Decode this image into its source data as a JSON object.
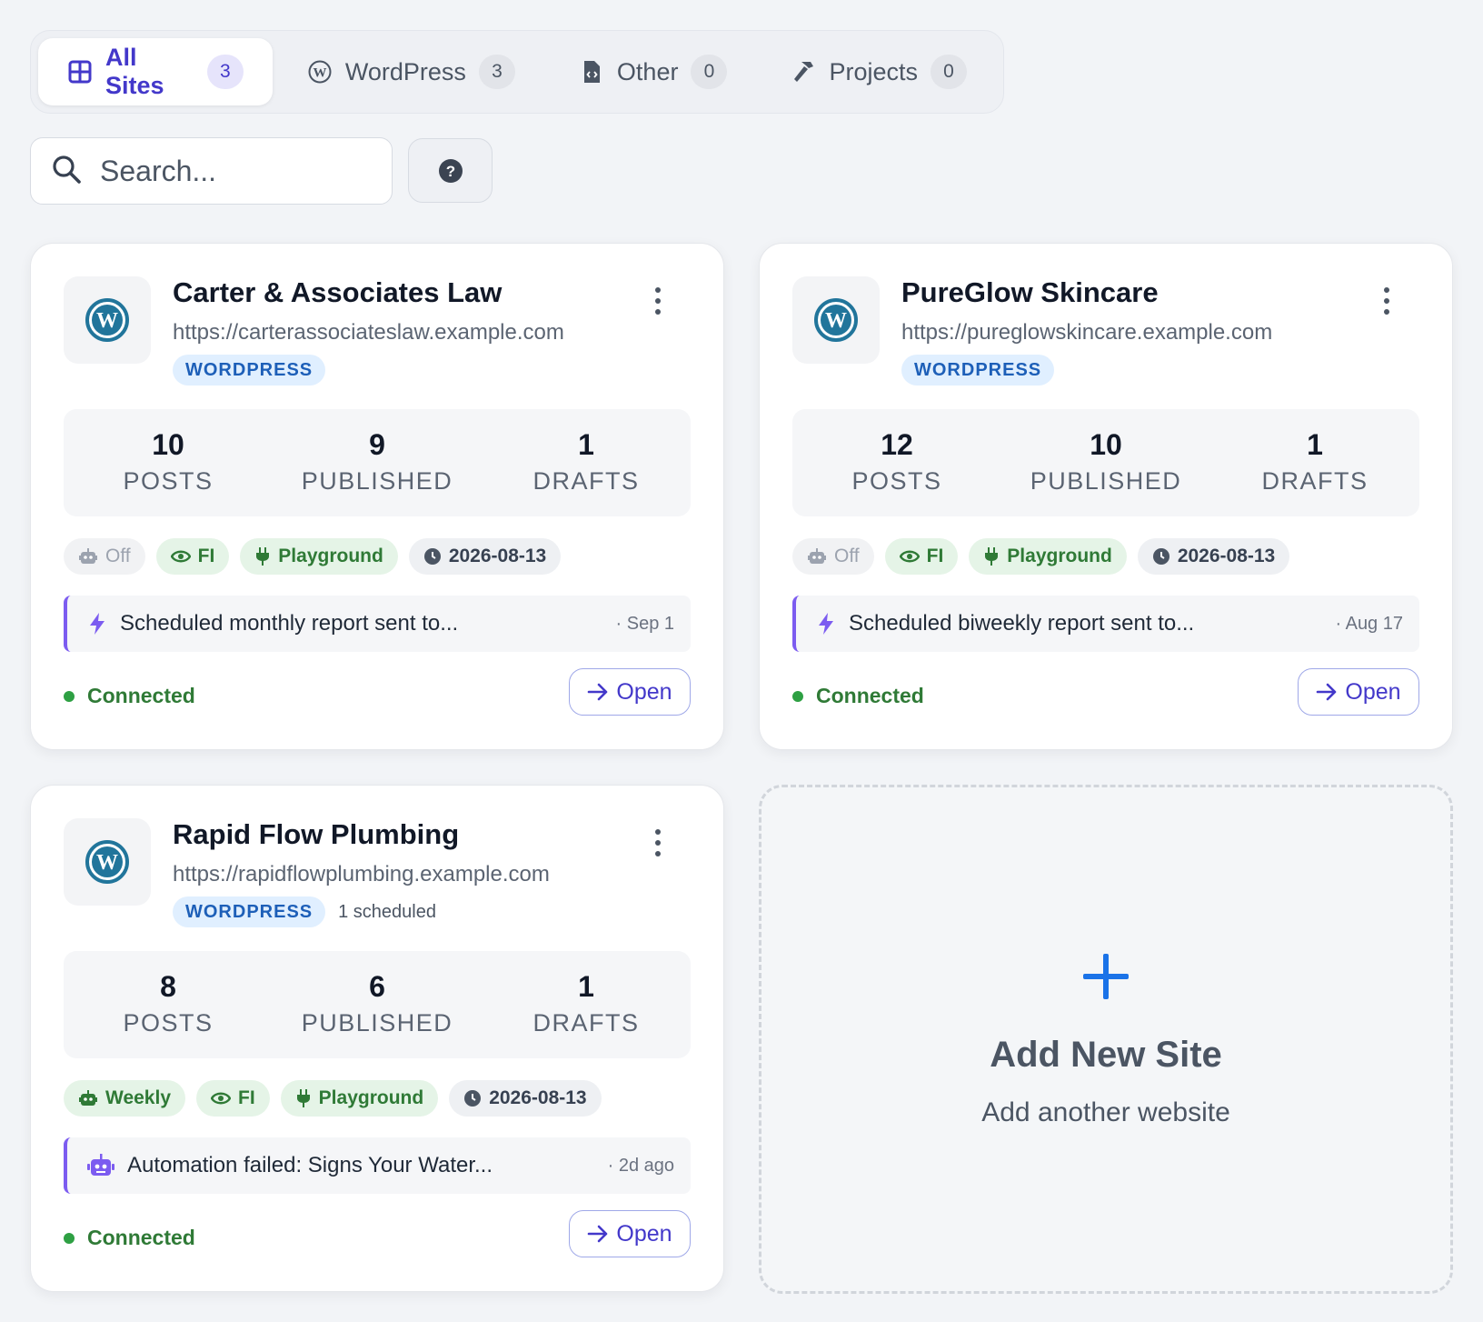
{
  "tabs": [
    {
      "label": "All Sites",
      "count": "3"
    },
    {
      "label": "WordPress",
      "count": "3"
    },
    {
      "label": "Other",
      "count": "0"
    },
    {
      "label": "Projects",
      "count": "0"
    }
  ],
  "search": {
    "placeholder": "Search..."
  },
  "help": {
    "icon": "?"
  },
  "sites": [
    {
      "name": "Carter & Associates Law",
      "url": "https://carterassociateslaw.example.com",
      "type": "WORDPRESS",
      "scheduled": "",
      "stats": [
        {
          "value": "10",
          "label": "POSTS"
        },
        {
          "value": "9",
          "label": "PUBLISHED"
        },
        {
          "value": "1",
          "label": "DRAFTS"
        }
      ],
      "automation": "Off",
      "fi": "FI",
      "playground": "Playground",
      "date": "2026-08-13",
      "activity": {
        "text": "Scheduled monthly report sent to...",
        "time": "· Sep 1",
        "icon": "bolt-icon"
      },
      "status": "Connected",
      "open": "Open"
    },
    {
      "name": "PureGlow Skincare",
      "url": "https://pureglowskincare.example.com",
      "type": "WORDPRESS",
      "scheduled": "",
      "stats": [
        {
          "value": "12",
          "label": "POSTS"
        },
        {
          "value": "10",
          "label": "PUBLISHED"
        },
        {
          "value": "1",
          "label": "DRAFTS"
        }
      ],
      "automation": "Off",
      "fi": "FI",
      "playground": "Playground",
      "date": "2026-08-13",
      "activity": {
        "text": "Scheduled biweekly report sent to...",
        "time": "· Aug 17",
        "icon": "bolt-icon"
      },
      "status": "Connected",
      "open": "Open"
    },
    {
      "name": "Rapid Flow Plumbing",
      "url": "https://rapidflowplumbing.example.com",
      "type": "WORDPRESS",
      "scheduled": "1 scheduled",
      "stats": [
        {
          "value": "8",
          "label": "POSTS"
        },
        {
          "value": "6",
          "label": "PUBLISHED"
        },
        {
          "value": "1",
          "label": "DRAFTS"
        }
      ],
      "automation": "Weekly",
      "fi": "FI",
      "playground": "Playground",
      "date": "2026-08-13",
      "activity": {
        "text": "Automation failed: Signs Your Water...",
        "time": "· 2d ago",
        "icon": "robot-icon"
      },
      "status": "Connected",
      "open": "Open"
    }
  ],
  "add_site": {
    "title": "Add New Site",
    "subtitle": "Add another website",
    "icon": "+"
  },
  "colors": {
    "accent": "#4338ca",
    "connected": "#2ea043",
    "wordpress_blue": "#21759b",
    "plus_blue": "#1a73e8"
  }
}
